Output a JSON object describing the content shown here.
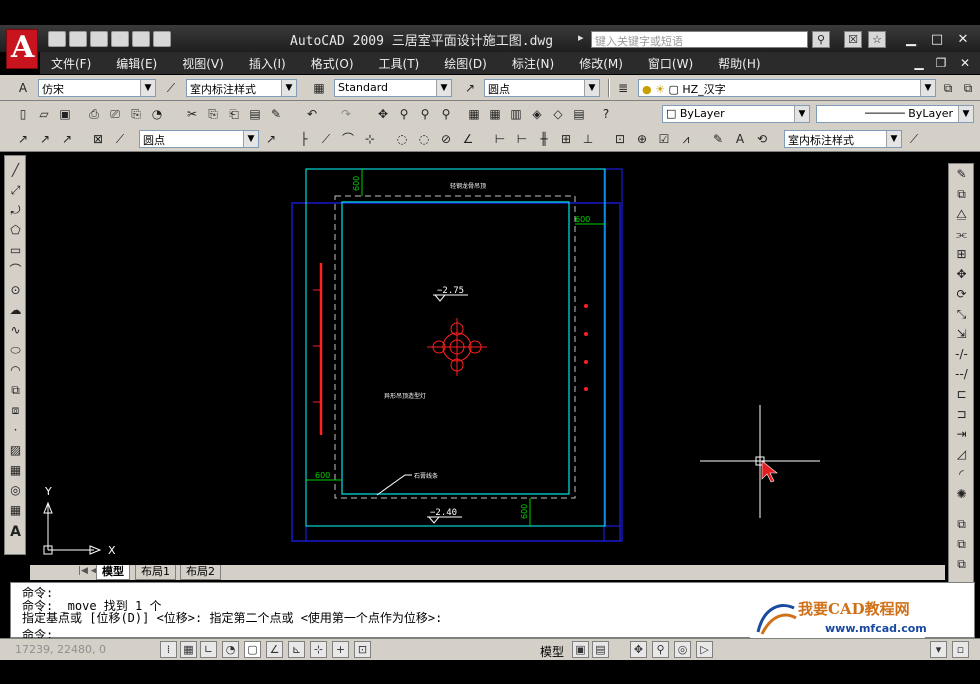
{
  "window": {
    "title": "AutoCAD 2009 三居室平面设计施工图.dwg",
    "search_placeholder": "键入关键字或短语"
  },
  "menu": [
    "文件(F)",
    "编辑(E)",
    "视图(V)",
    "插入(I)",
    "格式(O)",
    "工具(T)",
    "绘图(D)",
    "标注(N)",
    "修改(M)",
    "窗口(W)",
    "帮助(H)"
  ],
  "toolbar1": {
    "font_style": "仿宋",
    "dim_style": "室内标注样式",
    "table_style": "Standard",
    "multileader_style": "圆点",
    "layer": "HZ_汉字"
  },
  "toolbar2": {
    "color": "ByLayer",
    "linetype": "ByLayer"
  },
  "toolbar3": {
    "leader_style": "圆点",
    "dim_style": "室内标注样式"
  },
  "drawing": {
    "elev_top": "−2.75",
    "elev_bottom": "−2.40",
    "dim_600_a": "600",
    "dim_600_b": "600",
    "dim_600_c": "600",
    "dim_600_d": "600",
    "label_top": "轻钢龙骨吊顶",
    "label_mid": "异形吊顶造型灯",
    "label_bottom": "石膏线条",
    "ucs_x": "X",
    "ucs_y": "Y"
  },
  "layout_tabs": [
    "模型",
    "布局1",
    "布局2"
  ],
  "command_history": [
    "命令:",
    "命令:  _move 找到 1 个",
    "指定基点或 [位移(D)] <位移>:  指定第二个点或 <使用第一个点作为位移>:",
    "命令:"
  ],
  "status": {
    "coords": "17239, 22480, 0",
    "model_label": "模型"
  },
  "watermark": {
    "brand": "我要CAD教程网",
    "url": "www.mfcad.com"
  },
  "colors": {
    "ceiling_outline": "#00d4d4",
    "wall_blue": "#2020ff",
    "dimension_green": "#00d000",
    "lamp_red": "#ff2020"
  }
}
